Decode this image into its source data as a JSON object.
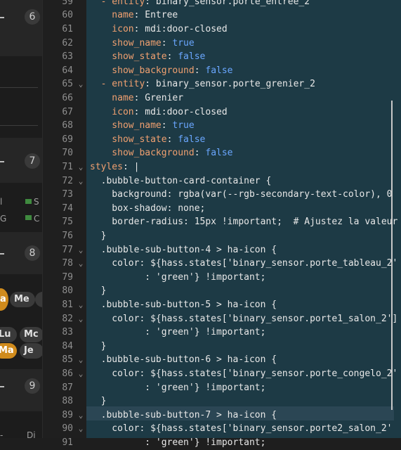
{
  "left_panel": {
    "badges": [
      "6",
      "7",
      "8",
      "9"
    ],
    "row_a": [
      "S",
      "C"
    ],
    "row_a_prefix": [
      "l",
      "G"
    ],
    "chips_1": [
      "a",
      "Me"
    ],
    "chips_2": [
      "Lu",
      "Mc"
    ],
    "chips_3": [
      "Ma",
      "Je"
    ],
    "bottom_text": [
      "-",
      "Di"
    ]
  },
  "editor": {
    "lines": [
      {
        "n": "59",
        "fold": "",
        "segs": [
          [
            "k",
            "  - entity"
          ],
          [
            "v",
            ": binary_sensor.porte_entree_2"
          ]
        ]
      },
      {
        "n": "60",
        "fold": "",
        "segs": [
          [
            "k",
            "    name"
          ],
          [
            "v",
            ": Entree"
          ]
        ]
      },
      {
        "n": "61",
        "fold": "",
        "segs": [
          [
            "k",
            "    icon"
          ],
          [
            "v",
            ": mdi:door-closed"
          ]
        ]
      },
      {
        "n": "62",
        "fold": "",
        "segs": [
          [
            "k",
            "    show_name"
          ],
          [
            "v",
            ": "
          ],
          [
            "b",
            "true"
          ]
        ]
      },
      {
        "n": "63",
        "fold": "",
        "segs": [
          [
            "k",
            "    show_state"
          ],
          [
            "v",
            ": "
          ],
          [
            "b",
            "false"
          ]
        ]
      },
      {
        "n": "64",
        "fold": "",
        "segs": [
          [
            "k",
            "    show_background"
          ],
          [
            "v",
            ": "
          ],
          [
            "b",
            "false"
          ]
        ]
      },
      {
        "n": "65",
        "fold": "v",
        "segs": [
          [
            "k",
            "  - entity"
          ],
          [
            "v",
            ": binary_sensor.porte_grenier_2"
          ]
        ]
      },
      {
        "n": "66",
        "fold": "",
        "segs": [
          [
            "k",
            "    name"
          ],
          [
            "v",
            ": Grenier"
          ]
        ]
      },
      {
        "n": "67",
        "fold": "",
        "segs": [
          [
            "k",
            "    icon"
          ],
          [
            "v",
            ": mdi:door-closed"
          ]
        ]
      },
      {
        "n": "68",
        "fold": "",
        "segs": [
          [
            "k",
            "    show_name"
          ],
          [
            "v",
            ": "
          ],
          [
            "b",
            "true"
          ]
        ]
      },
      {
        "n": "69",
        "fold": "",
        "segs": [
          [
            "k",
            "    show_state"
          ],
          [
            "v",
            ": "
          ],
          [
            "b",
            "false"
          ]
        ]
      },
      {
        "n": "70",
        "fold": "",
        "segs": [
          [
            "k",
            "    show_background"
          ],
          [
            "v",
            ": "
          ],
          [
            "b",
            "false"
          ]
        ]
      },
      {
        "n": "71",
        "fold": "v",
        "segs": [
          [
            "k",
            "styles"
          ],
          [
            "v",
            ": |"
          ]
        ]
      },
      {
        "n": "72",
        "fold": "v",
        "segs": [
          [
            "s",
            "  .bubble-button-card-container {"
          ]
        ]
      },
      {
        "n": "73",
        "fold": "",
        "segs": [
          [
            "s",
            "    background: rgba(var(--rgb-secondary-text-color), 0"
          ]
        ]
      },
      {
        "n": "74",
        "fold": "",
        "segs": [
          [
            "s",
            "    box-shadow: none;"
          ]
        ]
      },
      {
        "n": "75",
        "fold": "",
        "segs": [
          [
            "s",
            "    border-radius: 15px !important;  # Ajustez la valeur"
          ]
        ]
      },
      {
        "n": "76",
        "fold": "",
        "segs": [
          [
            "s",
            "  }"
          ]
        ]
      },
      {
        "n": "77",
        "fold": "v",
        "segs": [
          [
            "s",
            "  .bubble-sub-button-4 > ha-icon {"
          ]
        ]
      },
      {
        "n": "78",
        "fold": "v",
        "segs": [
          [
            "s",
            "    color: ${hass.states['binary_sensor.porte_tableau_2'"
          ]
        ]
      },
      {
        "n": "79",
        "fold": "",
        "segs": [
          [
            "s",
            "          : 'green'} !important;"
          ]
        ]
      },
      {
        "n": "80",
        "fold": "",
        "segs": [
          [
            "s",
            "  }"
          ]
        ]
      },
      {
        "n": "81",
        "fold": "v",
        "segs": [
          [
            "s",
            "  .bubble-sub-button-5 > ha-icon {"
          ]
        ]
      },
      {
        "n": "82",
        "fold": "v",
        "segs": [
          [
            "s",
            "    color: ${hass.states['binary_sensor.porte1_salon_2']"
          ]
        ]
      },
      {
        "n": "83",
        "fold": "",
        "segs": [
          [
            "s",
            "          : 'green'} !important;"
          ]
        ]
      },
      {
        "n": "84",
        "fold": "",
        "segs": [
          [
            "s",
            "  }"
          ]
        ]
      },
      {
        "n": "85",
        "fold": "v",
        "segs": [
          [
            "s",
            "  .bubble-sub-button-6 > ha-icon {"
          ]
        ]
      },
      {
        "n": "86",
        "fold": "v",
        "segs": [
          [
            "s",
            "    color: ${hass.states['binary_sensor.porte_congelo_2'"
          ]
        ]
      },
      {
        "n": "87",
        "fold": "",
        "segs": [
          [
            "s",
            "          : 'green'} !important;"
          ]
        ]
      },
      {
        "n": "88",
        "fold": "",
        "segs": [
          [
            "s",
            "  }"
          ]
        ]
      },
      {
        "n": "89",
        "fold": "v",
        "segs": [
          [
            "s",
            "  .bubble-sub-button-7 > ha-icon {"
          ]
        ]
      },
      {
        "n": "90",
        "fold": "v",
        "segs": [
          [
            "s",
            "    color: ${hass.states['binary_sensor.porte2_salon_2'"
          ]
        ]
      },
      {
        "n": "91",
        "fold": "",
        "segs": [
          [
            "s",
            "          : 'green'} !important;"
          ]
        ]
      }
    ]
  }
}
